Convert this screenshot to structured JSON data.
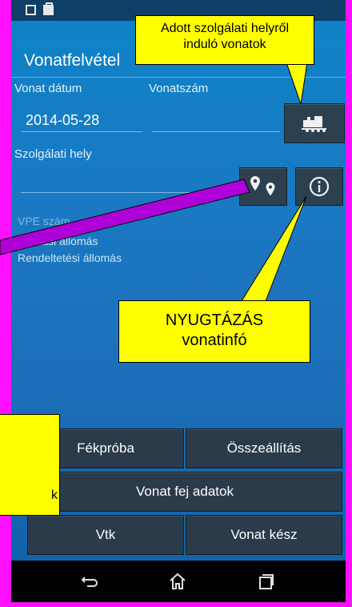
{
  "app": {
    "title": "Vonatfelvétel"
  },
  "form": {
    "date_label": "Vonat dátum",
    "date_value": "2014-05-28",
    "train_number_label": "Vonatszám",
    "station_label": "Szolgálati hely",
    "info_lines": [
      "VPE szám",
      "Indulási állomás",
      "Rendeltetési állomás"
    ]
  },
  "buttons": {
    "brake_test": "Fékpróba",
    "composition": "Összeállítás",
    "head_data": "Vonat fej adatok",
    "vtk": "Vtk",
    "ready": "Vonat kész"
  },
  "callouts": {
    "top": [
      "Adott szolgálati helyről",
      "induló vonatok"
    ],
    "middle": [
      "NYUGTÁZÁS",
      "vonatinfó"
    ],
    "bottom_left": "k"
  },
  "icons": {
    "train_button": "train-icon",
    "location_button": "map-pins-icon",
    "info_button": "info-icon",
    "nav_back": "back-icon",
    "nav_home": "home-icon",
    "nav_recent": "recent-apps-icon"
  },
  "colors": {
    "frame": "#ff10ff",
    "callout": "#ffff00",
    "arrow": "#b000d8",
    "screen": "#1b78c3"
  }
}
